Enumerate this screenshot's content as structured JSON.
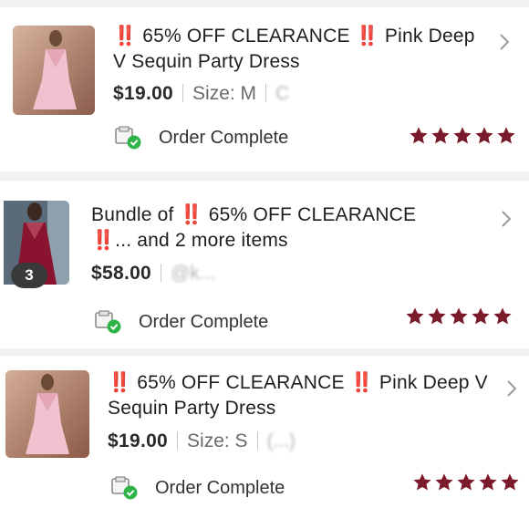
{
  "orders": [
    {
      "title_prefix": "‼️",
      "title_1": "65% OFF CLEARANCE",
      "title_mark": "‼️",
      "title_2": "Pink Deep V Sequin Party Dress",
      "price": "$19.00",
      "size_label": "Size: M",
      "extra": "C",
      "status": "Order Complete",
      "rating": 5
    },
    {
      "title_1": "Bundle of",
      "title_mark": "‼️",
      "title_2": "65% OFF CLEARANCE",
      "title_mark_2": "‼️",
      "title_3": "... and 2 more items",
      "price": "$58.00",
      "seller": "@k...",
      "item_count": "3",
      "status": "Order Complete",
      "rating": 5
    },
    {
      "title_prefix": "‼️",
      "title_1": "65% OFF CLEARANCE",
      "title_mark": "‼️",
      "title_2": "Pink Deep V Sequin Party Dress",
      "price": "$19.00",
      "size_label": "Size: S",
      "extra": "(...)",
      "status": "Order Complete",
      "rating": 5
    }
  ],
  "colors": {
    "star": "#7a1a2a",
    "check": "#2fb44a",
    "chevron": "#9a9a9a",
    "accent_red": "#d8262b"
  },
  "icons": {
    "chevron": "chevron-right-icon",
    "status": "package-check-icon",
    "star": "star-icon"
  }
}
